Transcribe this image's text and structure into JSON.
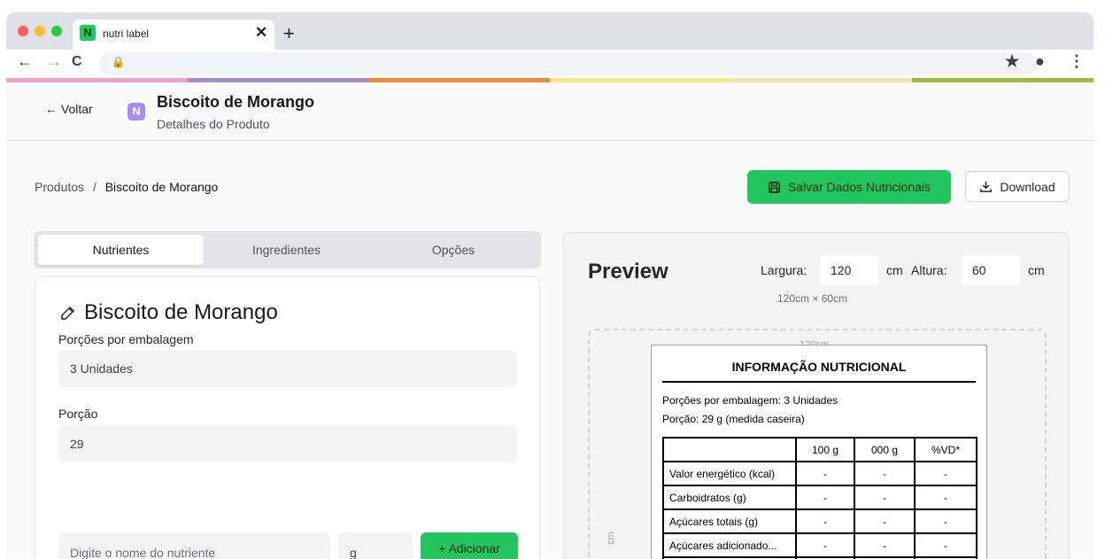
{
  "browser": {
    "tab_title": "nutri label",
    "tab_favicon_letter": "N",
    "close_glyph": "✕",
    "new_tab_glyph": "+",
    "back_glyph": "←",
    "forward_glyph": "→",
    "reload_glyph": "C",
    "lock_glyph": "🔒",
    "star_glyph": "★",
    "account_glyph": "●",
    "menu_glyph": "⋮",
    "colors": {
      "strip": "#dee1e6",
      "tab": "#ffffff"
    }
  },
  "rainbow_colors": [
    "#f0a3c4",
    "#a78bca",
    "#f08a3c",
    "#fde58a",
    "#ede4b8",
    "#9cba3c"
  ],
  "header": {
    "back_label": "← Voltar",
    "logo_letter": "N",
    "title": "Biscoito de Morango",
    "subtitle": "Detalhes do Produto"
  },
  "breadcrumb": {
    "root": "Produtos",
    "separator": "/",
    "current": "Biscoito de Morango"
  },
  "actions": {
    "save_label": "Salvar Dados Nutricionais",
    "download_label": "Download",
    "accent": "#22c55e"
  },
  "tabs": [
    {
      "label": "Nutrientes",
      "active": true
    },
    {
      "label": "Ingredientes",
      "active": false
    },
    {
      "label": "Opções",
      "active": false
    }
  ],
  "form": {
    "product_name": "Biscoito de Morango",
    "servings_label": "Porções por embalagem",
    "servings_value": "3 Unidades",
    "portion_label": "Porção",
    "portion_value": "29",
    "nutrient_placeholder": "Digite o nome do nutriente",
    "unit_value": "g",
    "add_label": "+ Adicionar"
  },
  "preview": {
    "title": "Preview",
    "width_label": "Largura:",
    "width_value": "120",
    "width_unit": "cm",
    "height_label": "Altura:",
    "height_value": "60",
    "height_unit": "cm",
    "dims_text": "120cm × 60cm",
    "ruler_top": "120cm",
    "ruler_left": "cm"
  },
  "nutrition_label": {
    "heading": "INFORMAÇÃO NUTRICIONAL",
    "servings_line": "Porções por embalagem: 3 Unidades",
    "portion_line": "Porção: 29 g (medida caseira)",
    "columns": [
      "",
      "100 g",
      "000 g",
      "%VD*"
    ],
    "rows": [
      [
        "Valor energético (kcal)",
        "-",
        "-",
        "-"
      ],
      [
        "Carboidratos (g)",
        "-",
        "-",
        "-"
      ],
      [
        "Açúcares totais (g)",
        "-",
        "-",
        "-"
      ],
      [
        "Açúcares adicionado...",
        "-",
        "-",
        "-"
      ]
    ]
  }
}
